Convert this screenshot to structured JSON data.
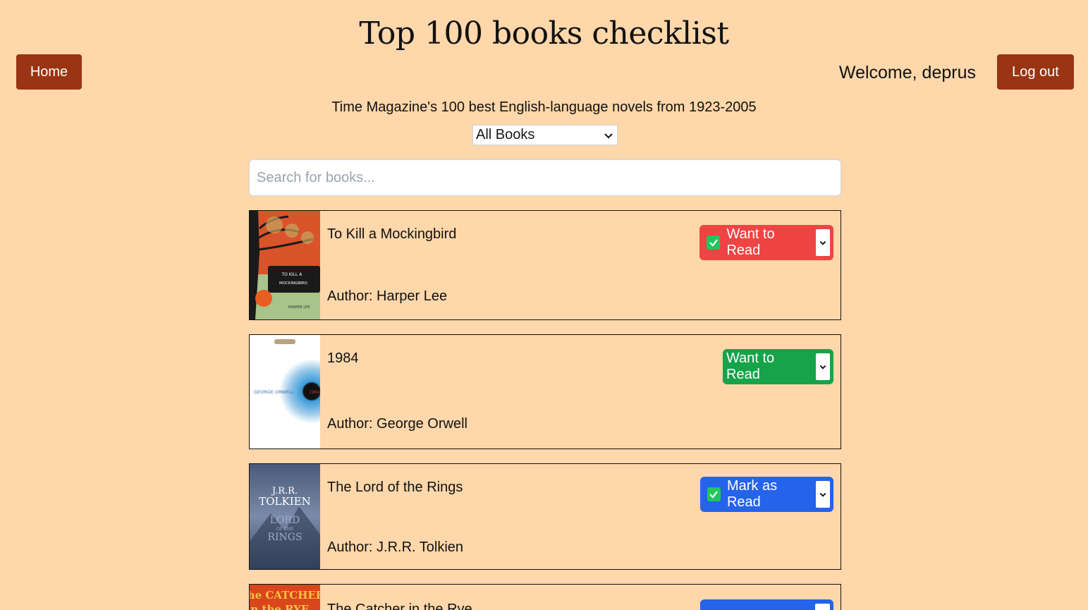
{
  "header": {
    "title": "Top 100 books checklist",
    "home_label": "Home",
    "welcome": "Welcome, deprus",
    "logout_label": "Log out",
    "subtitle": "Time Magazine's 100 best English-language novels from 1923-2005"
  },
  "filter": {
    "selected": "All Books"
  },
  "search": {
    "placeholder": "Search for books..."
  },
  "books": [
    {
      "title": "To Kill a Mockingbird",
      "author": "Author: Harper Lee",
      "status": "Want to Read",
      "checked": true,
      "status_color": "#ef4444",
      "cover_text": [
        "TO KILL A",
        "MOCKINGBIRD",
        "HARPER LEE"
      ]
    },
    {
      "title": "1984",
      "author": "Author: George Orwell",
      "status": "Want to Read",
      "checked": false,
      "status_color": "#16a34a",
      "cover_text": [
        "GEORGE ORWELL",
        "1984"
      ]
    },
    {
      "title": "The Lord of the Rings",
      "author": "Author: J.R.R. Tolkien",
      "status": "Mark as Read",
      "checked": true,
      "status_color": "#2563eb",
      "cover_text": [
        "J.R.R.",
        "TOLKIEN",
        "LORD",
        "OF THE",
        "RINGS"
      ]
    },
    {
      "title": "The Catcher in the Rye",
      "author": "",
      "status": "",
      "checked": false,
      "status_color": "#2563eb",
      "cover_text": [
        "the CATCHER",
        "in the RYE"
      ]
    }
  ]
}
